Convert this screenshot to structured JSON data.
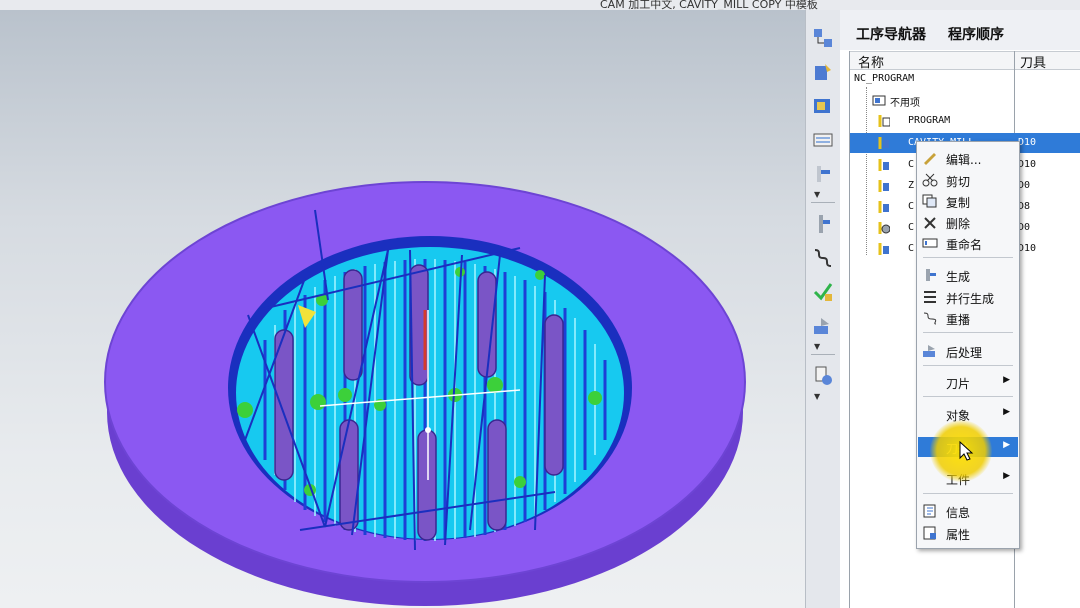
{
  "window": {
    "title": "CAM 加工中文, CAVITY_MILL COPY 中模板"
  },
  "navigator": {
    "tabs": [
      "工序导航器",
      "程序顺序"
    ],
    "columns": [
      "名称",
      "刀具"
    ],
    "rows": [
      {
        "name": "NC_PROGRAM",
        "tool": "",
        "icon": "root",
        "selected": false
      },
      {
        "name": "不用项",
        "tool": "",
        "icon": "folder-icon",
        "selected": false
      },
      {
        "name": "PROGRAM",
        "tool": "",
        "icon": "program-folder-icon",
        "selected": false
      },
      {
        "name": "CAVITY_MILL",
        "tool": "D10",
        "icon": "cavity-mill-icon",
        "selected": true
      },
      {
        "name": "C",
        "tool": "D10",
        "icon": "cavity-mill-icon",
        "selected": false
      },
      {
        "name": "Z",
        "tool": "D0",
        "icon": "cavity-mill-icon",
        "selected": false
      },
      {
        "name": "C",
        "tool": "D8",
        "icon": "cavity-mill-icon",
        "selected": false
      },
      {
        "name": "C",
        "tool": "D0",
        "icon": "planar-mill-icon",
        "selected": false
      },
      {
        "name": "C",
        "tool": "D10",
        "icon": "cavity-mill-icon",
        "selected": false
      }
    ]
  },
  "context_menu": {
    "items": [
      {
        "label": "编辑...",
        "icon": "edit-icon",
        "submenu": false
      },
      {
        "label": "剪切",
        "icon": "cut-icon",
        "submenu": false
      },
      {
        "label": "复制",
        "icon": "copy-icon",
        "submenu": false
      },
      {
        "label": "删除",
        "icon": "delete-icon",
        "submenu": false
      },
      {
        "label": "重命名",
        "icon": "rename-icon",
        "submenu": false
      },
      {
        "label": "生成",
        "icon": "generate-icon",
        "submenu": false
      },
      {
        "label": "并行生成",
        "icon": "parallel-generate-icon",
        "submenu": false
      },
      {
        "label": "重播",
        "icon": "replay-icon",
        "submenu": false
      },
      {
        "label": "后处理",
        "icon": "postprocess-icon",
        "submenu": false
      },
      {
        "label": "刀片",
        "icon": "",
        "submenu": true
      },
      {
        "label": "对象",
        "icon": "",
        "submenu": true
      },
      {
        "label": "刀轨",
        "icon": "",
        "submenu": true,
        "highlighted": true
      },
      {
        "label": "工件",
        "icon": "",
        "submenu": true
      },
      {
        "label": "信息",
        "icon": "info-icon",
        "submenu": false
      },
      {
        "label": "属性",
        "icon": "properties-icon",
        "submenu": false
      }
    ]
  },
  "resource_bar": {
    "icons": [
      "assembly-navigator-icon",
      "constraint-navigator-icon",
      "part-navigator-icon",
      "reuse-library-icon",
      "operation-navigator-icon",
      "machine-tool-icon",
      "generate-toolpath-icon",
      "verify-toolpath-icon",
      "postprocess-icon",
      "shop-doc-icon",
      "roles-icon"
    ]
  },
  "colors": {
    "part": "#8b58f2",
    "toolpath": "#1e3fd6",
    "cavity_floor": "#17c9f0",
    "selection": "#2f7bd8",
    "cursor_highlight": "#f2d200"
  }
}
